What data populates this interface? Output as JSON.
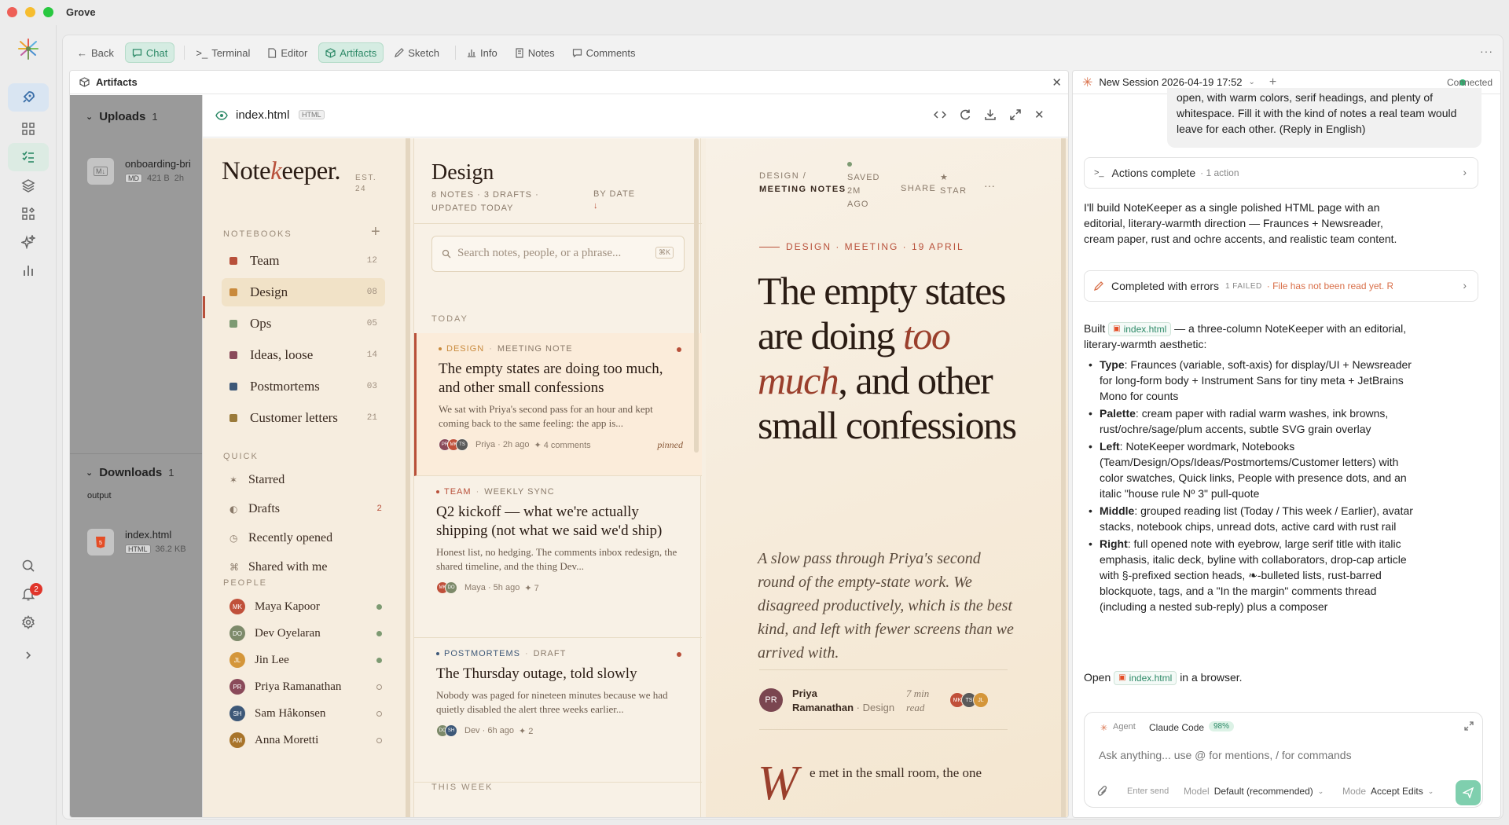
{
  "app": {
    "title": "Grove"
  },
  "toolbar": {
    "back": "Back",
    "chat": "Chat",
    "terminal": "Terminal",
    "editor": "Editor",
    "artifacts": "Artifacts",
    "sketch": "Sketch",
    "info": "Info",
    "notes": "Notes",
    "comments": "Comments"
  },
  "rail": {
    "notification_count": "2"
  },
  "artifacts": {
    "title": "Artifacts",
    "uploads": {
      "label": "Uploads",
      "count": "1",
      "file": {
        "name": "onboarding-bri",
        "type": "MD",
        "size": "421 B",
        "age": "2h"
      }
    },
    "downloads": {
      "label": "Downloads",
      "count": "1",
      "folder": "output",
      "file": {
        "name": "index.html",
        "type": "HTML",
        "size": "36.2 KB"
      }
    },
    "preview": {
      "filename": "index.html",
      "type": "HTML"
    }
  },
  "nk": {
    "logo_pre": "Note",
    "logo_k": "k",
    "logo_post": "eeper.",
    "est": "EST.",
    "est_num": "24",
    "notebooks_label": "NOTEBOOKS",
    "notebooks": [
      {
        "name": "Team",
        "count": "12",
        "color": "#b8503a"
      },
      {
        "name": "Design",
        "count": "08",
        "color": "#c98a3c"
      },
      {
        "name": "Ops",
        "count": "05",
        "color": "#7d9a72"
      },
      {
        "name": "Ideas, loose",
        "count": "14",
        "color": "#8a4a5a"
      },
      {
        "name": "Postmortems",
        "count": "03",
        "color": "#3d5878"
      },
      {
        "name": "Customer letters",
        "count": "21",
        "color": "#9a7a3a"
      }
    ],
    "quick_label": "QUICK",
    "quick": [
      {
        "icon": "✶",
        "label": "Starred",
        "count": ""
      },
      {
        "icon": "◐",
        "label": "Drafts",
        "count": "2"
      },
      {
        "icon": "◷",
        "label": "Recently opened",
        "count": ""
      },
      {
        "icon": "⌘",
        "label": "Shared with me",
        "count": ""
      }
    ],
    "people_label": "PEOPLE",
    "people": [
      {
        "initials": "MK",
        "name": "Maya Kapoor",
        "color": "#c0503a",
        "online": true
      },
      {
        "initials": "DO",
        "name": "Dev Oyelaran",
        "color": "#7d8a6a",
        "online": true
      },
      {
        "initials": "JL",
        "name": "Jin Lee",
        "color": "#d4963a",
        "online": true
      },
      {
        "initials": "PR",
        "name": "Priya Ramanathan",
        "color": "#8a4a5a",
        "online": false
      },
      {
        "initials": "SH",
        "name": "Sam Håkonsen",
        "color": "#3d5878",
        "online": false
      },
      {
        "initials": "AM",
        "name": "Anna Moretti",
        "color": "#a8742a",
        "online": false
      }
    ],
    "list": {
      "title": "Design",
      "meta": "8 NOTES · 3 DRAFTS · UPDATED TODAY",
      "sort": "BY DATE",
      "sort_arrow": "↓",
      "search_placeholder": "Search notes, people, or a phrase...",
      "search_kbd": "⌘K",
      "today": "TODAY",
      "this_week": "THIS WEEK",
      "cards": [
        {
          "nb": "DESIGN",
          "nb_color": "#c98a3c",
          "kind": "MEETING NOTE",
          "title": "The empty states are doing too much, and other small confessions",
          "excerpt": "We sat with Priya's second pass for an hour and kept coming back to the same feeling: the app is...",
          "avatars": [
            "PR",
            "MK",
            "TS"
          ],
          "author": "Priya · 2h ago",
          "extra": "✦ 4 comments",
          "flag": "pinned"
        },
        {
          "nb": "TEAM",
          "nb_color": "#b8503a",
          "kind": "WEEKLY SYNC",
          "title": "Q2 kickoff — what we're actually shipping (not what we said we'd ship)",
          "excerpt": "Honest list, no hedging. The comments inbox redesign, the shared timeline, and the thing Dev...",
          "avatars": [
            "MK",
            "DO"
          ],
          "author": "Maya · 5h ago",
          "extra": "✦ 7",
          "flag": ""
        },
        {
          "nb": "POSTMORTEMS",
          "nb_color": "#3d5878",
          "kind": "DRAFT",
          "title": "The Thursday outage, told slowly",
          "excerpt": "Nobody was paged for nineteen minutes because we had quietly disabled the alert three weeks earlier...",
          "avatars": [
            "DO",
            "SH"
          ],
          "author": "Dev · 6h ago",
          "extra": "✦ 2",
          "flag": ""
        }
      ]
    },
    "note": {
      "crumb1": "DESIGN /",
      "crumb2": "MEETING NOTES",
      "saved": "SAVED 2M AGO",
      "share": "SHARE",
      "star": "★ STAR",
      "more": "···",
      "eyebrow": "DESIGN · MEETING · 19 APRIL",
      "title_a": "The empty states are doing ",
      "title_em": "too much",
      "title_b": ", and other small confessions",
      "deck": "A slow pass through Priya's second round of the empty-state work. We disagreed productively, which is the best kind, and left with fewer screens than we arrived with.",
      "author_initials": "PR",
      "author_first": "Priya",
      "author_last": "Ramanathan",
      "author_nb": "· Design",
      "read": "7 min read",
      "collab": [
        "MK",
        "TS",
        "JL"
      ],
      "dropcap": "W",
      "body": "e met in the small room, the one"
    }
  },
  "chat": {
    "session": "New Session 2026-04-19 17:52",
    "status": "Connected",
    "user_msg": "open, with warm colors, serif headings, and plenty of whitespace. Fill it with the kind of notes a real team would leave for each other. (Reply in English)",
    "actions": {
      "label": "Actions complete",
      "meta": "· 1 action"
    },
    "intro": "I'll build NoteKeeper as a single polished HTML page with an editorial, literary-warmth direction — Fraunces + Newsreader, cream paper, rust and ochre accents, and realistic team content.",
    "errors": {
      "label": "Completed with errors",
      "meta": "1 FAILED",
      "detail": "· File has not been read yet. Read it f..."
    },
    "built_pre": "Built",
    "built_chip": "index.html",
    "built_post": "— a three-column NoteKeeper with an editorial, literary-warmth aesthetic:",
    "bullets": [
      {
        "key": "Type",
        "text": ": Fraunces (variable, soft-axis) for display/UI + Newsreader for long-form body + Instrument Sans for tiny meta + JetBrains Mono for counts"
      },
      {
        "key": "Palette",
        "text": ": cream paper with radial warm washes, ink browns, rust/ochre/sage/plum accents, subtle SVG grain overlay"
      },
      {
        "key": "Left",
        "text": ": NoteKeeper wordmark, Notebooks (Team/Design/Ops/Ideas/Postmortems/Customer letters) with color swatches, Quick links, People with presence dots, and an italic \"house rule Nº 3\" pull-quote"
      },
      {
        "key": "Middle",
        "text": ": grouped reading list (Today / This week / Earlier), avatar stacks, notebook chips, unread dots, active card with rust rail"
      },
      {
        "key": "Right",
        "text": ": full opened note with eyebrow, large serif title with italic emphasis, italic deck, byline with collaborators, drop-cap article with §-prefixed section heads, ❧-bulleted lists, rust-barred blockquote, tags, and a \"In the margin\" comments thread (including a nested sub-reply) plus a composer"
      }
    ],
    "open_pre": "Open",
    "open_chip": "index.html",
    "open_post": "in a browser.",
    "composer": {
      "agent_label": "Agent",
      "agent": "Claude Code",
      "pct": "98%",
      "placeholder": "Ask anything... use @ for mentions, / for commands",
      "enter": "Enter send",
      "model_label": "Model",
      "model": "Default (recommended)",
      "mode_label": "Mode",
      "mode": "Accept Edits"
    }
  }
}
